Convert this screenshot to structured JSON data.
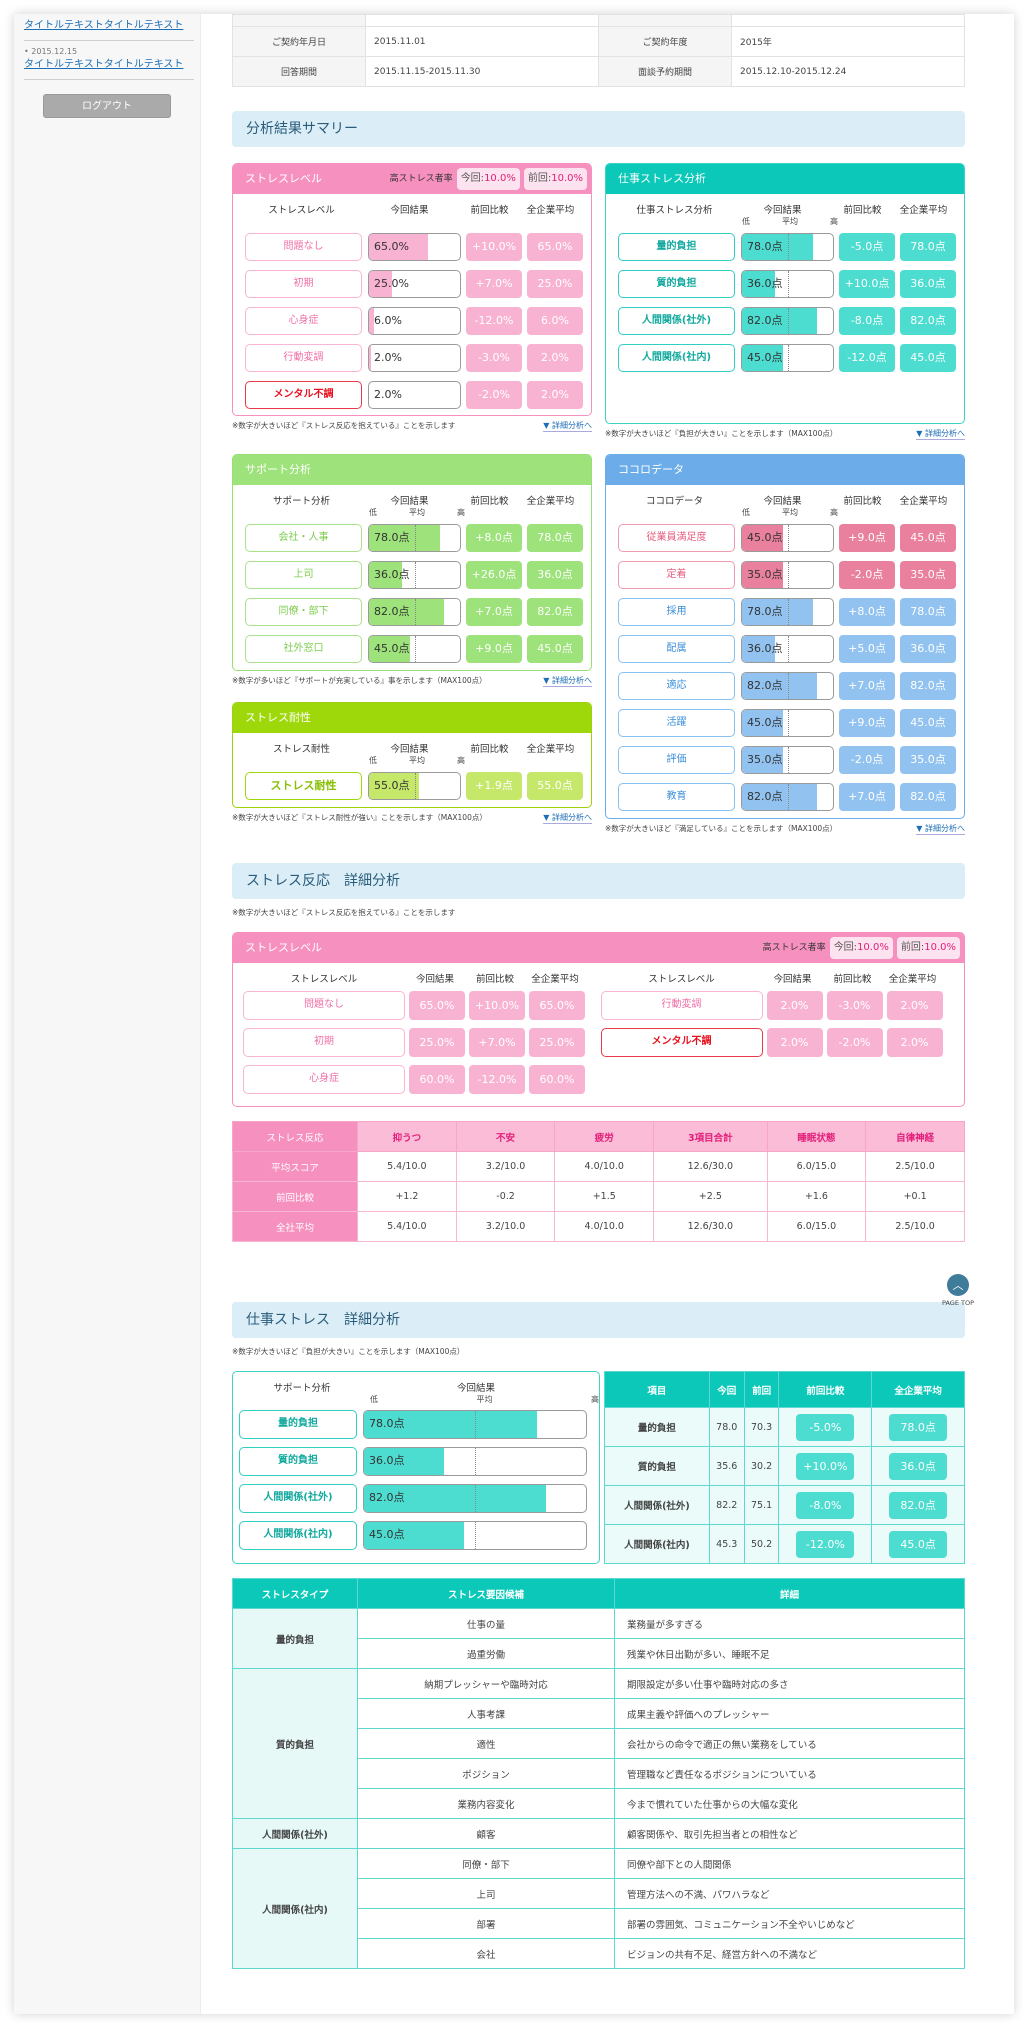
{
  "sidebar": {
    "news": [
      {
        "date": "",
        "title": "タイトルテキストタイトルテキスト"
      },
      {
        "date": "• 2015.12.15",
        "title": "タイトルテキストタイトルテキスト"
      }
    ],
    "logout_label": "ログアウト"
  },
  "info": {
    "rows": [
      [
        {
          "k": "ご契約年月日",
          "v": "2015.11.01"
        },
        {
          "k": "ご契約年度",
          "v": "2015年"
        }
      ],
      [
        {
          "k": "回答期間",
          "v": "2015.11.15-2015.11.30"
        },
        {
          "k": "面談予約期間",
          "v": "2015.12.10-2015.12.24"
        }
      ]
    ]
  },
  "summary": {
    "title": "分析結果サマリー",
    "common": {
      "current": "今回結果",
      "diff": "前回比較",
      "avg": "全企業平均",
      "low": "低",
      "mid": "平均",
      "high": "高",
      "detail_link": "▼ 詳細分析へ"
    },
    "stress_level": {
      "title": "ストレスレベル",
      "high_stress_label": "高ストレス者率",
      "current_label": "今回:",
      "current_value": "10.0%",
      "prev_label": "前回:",
      "prev_value": "10.0%",
      "col_label": "ストレスレベル",
      "rows": [
        {
          "label": "問題なし",
          "value": "65.0%",
          "pct": 65,
          "diff": "+10.0%",
          "avg": "65.0%"
        },
        {
          "label": "初期",
          "value": "25.0%",
          "pct": 25,
          "diff": "+7.0%",
          "avg": "25.0%"
        },
        {
          "label": "心身症",
          "value": "6.0%",
          "pct": 6,
          "diff": "-12.0%",
          "avg": "6.0%"
        },
        {
          "label": "行動変調",
          "value": "2.0%",
          "pct": 2,
          "diff": "-3.0%",
          "avg": "2.0%"
        },
        {
          "label": "メンタル不調",
          "value": "2.0%",
          "pct": 0,
          "diff": "-2.0%",
          "avg": "2.0%",
          "danger": true
        }
      ],
      "note": "※数字が大きいほど『ストレス反応を抱えている』ことを示します"
    },
    "work_stress": {
      "title": "仕事ストレス分析",
      "col_label": "仕事ストレス分析",
      "rows": [
        {
          "label": "量的負担",
          "value": "78.0点",
          "pct": 78,
          "diff": "-5.0点",
          "avg": "78.0点"
        },
        {
          "label": "質的負担",
          "value": "36.0点",
          "pct": 36,
          "diff": "+10.0点",
          "avg": "36.0点"
        },
        {
          "label": "人間関係(社外)",
          "value": "82.0点",
          "pct": 82,
          "diff": "-8.0点",
          "avg": "82.0点"
        },
        {
          "label": "人間関係(社内)",
          "value": "45.0点",
          "pct": 45,
          "diff": "-12.0点",
          "avg": "45.0点"
        }
      ],
      "note": "※数字が大きいほど『負担が大きい』ことを示します（MAX100点）"
    },
    "support": {
      "title": "サポート分析",
      "col_label": "サポート分析",
      "rows": [
        {
          "label": "会社・人事",
          "value": "78.0点",
          "pct": 78,
          "diff": "+8.0点",
          "avg": "78.0点"
        },
        {
          "label": "上司",
          "value": "36.0点",
          "pct": 36,
          "diff": "+26.0点",
          "avg": "36.0点"
        },
        {
          "label": "同僚・部下",
          "value": "82.0点",
          "pct": 82,
          "diff": "+7.0点",
          "avg": "82.0点"
        },
        {
          "label": "社外窓口",
          "value": "45.0点",
          "pct": 45,
          "diff": "+9.0点",
          "avg": "45.0点"
        }
      ],
      "note": "※数字が多いほど『サポートが充実している』事を示します（MAX100点）"
    },
    "resilience": {
      "title": "ストレス耐性",
      "col_label": "ストレス耐性",
      "rows": [
        {
          "label": "ストレス耐性",
          "value": "55.0点",
          "pct": 55,
          "diff": "+1.9点",
          "avg": "55.0点"
        }
      ],
      "note": "※数字が大きいほど『ストレス耐性が強い』ことを示します（MAX100点）"
    },
    "kokoro": {
      "title": "ココロデータ",
      "col_label": "ココロデータ",
      "rows": [
        {
          "label": "従業員満足度",
          "value": "45.0点",
          "pct": 45,
          "diff": "+9.0点",
          "avg": "45.0点",
          "alert": true
        },
        {
          "label": "定着",
          "value": "35.0点",
          "pct": 45,
          "diff": "-2.0点",
          "avg": "35.0点",
          "alert": true
        },
        {
          "label": "採用",
          "value": "78.0点",
          "pct": 78,
          "diff": "+8.0点",
          "avg": "78.0点"
        },
        {
          "label": "配属",
          "value": "36.0点",
          "pct": 36,
          "diff": "+5.0点",
          "avg": "36.0点"
        },
        {
          "label": "適応",
          "value": "82.0点",
          "pct": 82,
          "diff": "+7.0点",
          "avg": "82.0点"
        },
        {
          "label": "活躍",
          "value": "45.0点",
          "pct": 45,
          "diff": "+9.0点",
          "avg": "45.0点"
        },
        {
          "label": "評価",
          "value": "35.0点",
          "pct": 45,
          "diff": "-2.0点",
          "avg": "35.0点"
        },
        {
          "label": "教育",
          "value": "82.0点",
          "pct": 82,
          "diff": "+7.0点",
          "avg": "82.0点"
        }
      ],
      "note": "※数字が大きいほど『満足している』ことを示します（MAX100点）"
    }
  },
  "stress_detail": {
    "title": "ストレス反応　詳細分析",
    "note": "※数字が大きいほど『ストレス反応を抱えている』ことを示します",
    "panel_title": "ストレスレベル",
    "high_stress_label": "高ストレス者率",
    "current_label": "今回:",
    "current_value": "10.0%",
    "prev_label": "前回:",
    "prev_value": "10.0%",
    "col_label": "ストレスレベル",
    "left": [
      {
        "label": "問題なし",
        "value": "65.0%",
        "diff": "+10.0%",
        "avg": "65.0%"
      },
      {
        "label": "初期",
        "value": "25.0%",
        "diff": "+7.0%",
        "avg": "25.0%"
      },
      {
        "label": "心身症",
        "value": "60.0%",
        "diff": "-12.0%",
        "avg": "60.0%"
      }
    ],
    "right": [
      {
        "label": "行動変調",
        "value": "2.0%",
        "diff": "-3.0%",
        "avg": "2.0%"
      },
      {
        "label": "メンタル不調",
        "value": "2.0%",
        "diff": "-2.0%",
        "avg": "2.0%",
        "danger": true
      }
    ],
    "reaction_table": {
      "headers": [
        "ストレス反応",
        "抑うつ",
        "不安",
        "疲労",
        "3項目合計",
        "睡眠状態",
        "自律神経"
      ],
      "rows": [
        [
          "平均スコア",
          "5.4/10.0",
          "3.2/10.0",
          "4.0/10.0",
          "12.6/30.0",
          "6.0/15.0",
          "2.5/10.0"
        ],
        [
          "前回比較",
          "+1.2",
          "-0.2",
          "+1.5",
          "+2.5",
          "+1.6",
          "+0.1"
        ],
        [
          "全社平均",
          "5.4/10.0",
          "3.2/10.0",
          "4.0/10.0",
          "12.6/30.0",
          "6.0/15.0",
          "2.5/10.0"
        ]
      ]
    },
    "page_top_label": "PAGE TOP"
  },
  "work_detail": {
    "title": "仕事ストレス　詳細分析",
    "note": "※数字が大きいほど『負担が大きい』ことを示します（MAX100点）",
    "col_label": "サポート分析",
    "current_label": "今回結果",
    "bars": [
      {
        "label": "量的負担",
        "value": "78.0点",
        "pct": 78
      },
      {
        "label": "質的負担",
        "value": "36.0点",
        "pct": 36
      },
      {
        "label": "人間関係(社外)",
        "value": "82.0点",
        "pct": 82
      },
      {
        "label": "人間関係(社内)",
        "value": "45.0点",
        "pct": 45
      }
    ],
    "table": {
      "headers": [
        "項目",
        "今回",
        "前回",
        "前回比較",
        "全企業平均"
      ],
      "rows": [
        [
          "量的負担",
          "78.0",
          "70.3",
          "-5.0%",
          "78.0点"
        ],
        [
          "質的負担",
          "35.6",
          "30.2",
          "+10.0%",
          "36.0点"
        ],
        [
          "人間関係(社外)",
          "82.2",
          "75.1",
          "-8.0%",
          "82.0点"
        ],
        [
          "人間関係(社内)",
          "45.3",
          "50.2",
          "-12.0%",
          "45.0点"
        ]
      ]
    },
    "factor_table": {
      "headers": [
        "ストレスタイプ",
        "ストレス要因候補",
        "詳細"
      ],
      "groups": [
        {
          "type": "量的負担",
          "items": [
            [
              "仕事の量",
              "業務量が多すぎる"
            ],
            [
              "過重労働",
              "残業や休日出勤が多い、睡眠不足"
            ]
          ]
        },
        {
          "type": "質的負担",
          "items": [
            [
              "納期プレッシャーや臨時対応",
              "期限設定が多い仕事や臨時対応の多さ"
            ],
            [
              "人事考課",
              "成果主義や評価へのプレッシャー"
            ],
            [
              "適性",
              "会社からの命令で適正の無い業務をしている"
            ],
            [
              "ポジション",
              "管理職など責任なるポジションについている"
            ],
            [
              "業務内容変化",
              "今まで慣れていた仕事からの大幅な変化"
            ]
          ]
        },
        {
          "type": "人間関係(社外)",
          "items": [
            [
              "顧客",
              "顧客関係や、取引先担当者との相性など"
            ]
          ]
        },
        {
          "type": "人間関係(社内)",
          "items": [
            [
              "同僚・部下",
              "同僚や部下との人間関係"
            ],
            [
              "上司",
              "管理方法への不満、パワハラなど"
            ],
            [
              "部署",
              "部署の雰囲気、コミュニケーション不全やいじめなど"
            ],
            [
              "会社",
              "ビジョンの共有不足、経営方針への不満など"
            ]
          ]
        }
      ]
    }
  }
}
